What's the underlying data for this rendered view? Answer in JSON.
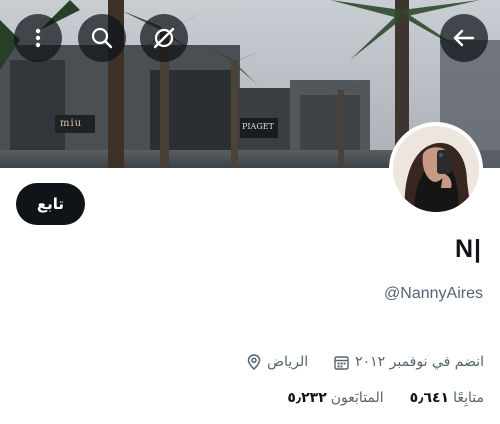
{
  "profile": {
    "display_name": "N|",
    "handle": "@NannyAires",
    "location": "الرياض",
    "joined": "انضم في نوفمبر ٢٠١٢",
    "following_count": "٥٫٢٣٢",
    "following_label": "المتابَعون",
    "followers_count": "٥٫٦٤١",
    "followers_label": "متابِعًا"
  },
  "actions": {
    "follow_label": "تابع"
  },
  "banner": {
    "store_sign_left": "miu",
    "store_sign_right": "PIAGET"
  },
  "icons": {
    "more": "more-vertical-icon",
    "search": "search-icon",
    "grok": "grok-icon",
    "back": "back-arrow-icon",
    "location": "location-pin-icon",
    "calendar": "calendar-icon"
  },
  "colors": {
    "text_primary": "#0f1419",
    "text_secondary": "#536471",
    "follow_button_bg": "#0f1419",
    "overlay_button_bg": "rgba(15,20,25,0.72)"
  }
}
